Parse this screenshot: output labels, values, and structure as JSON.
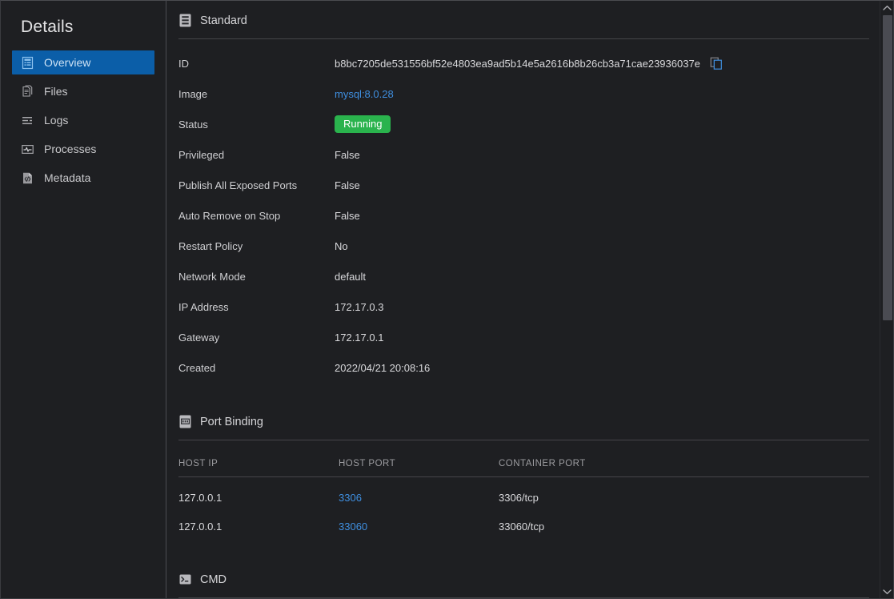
{
  "sidebar": {
    "title": "Details",
    "items": [
      {
        "label": "Overview",
        "icon": "overview-icon",
        "selected": true
      },
      {
        "label": "Files",
        "icon": "files-icon",
        "selected": false
      },
      {
        "label": "Logs",
        "icon": "logs-icon",
        "selected": false
      },
      {
        "label": "Processes",
        "icon": "processes-icon",
        "selected": false
      },
      {
        "label": "Metadata",
        "icon": "metadata-icon",
        "selected": false
      }
    ]
  },
  "standard": {
    "section_title": "Standard",
    "section_icon": "list-document-icon",
    "rows": [
      {
        "key": "ID",
        "value": "b8bc7205de531556bf52e4803ea9ad5b14e5a2616b8b26cb3a71cae23936037e",
        "kind": "text-copy"
      },
      {
        "key": "Image",
        "value": "mysql:8.0.28",
        "kind": "link"
      },
      {
        "key": "Status",
        "value": "Running",
        "kind": "badge"
      },
      {
        "key": "Privileged",
        "value": "False",
        "kind": "text"
      },
      {
        "key": "Publish All Exposed Ports",
        "value": "False",
        "kind": "text"
      },
      {
        "key": "Auto Remove on Stop",
        "value": "False",
        "kind": "text"
      },
      {
        "key": "Restart Policy",
        "value": "No",
        "kind": "text"
      },
      {
        "key": "Network Mode",
        "value": "default",
        "kind": "text"
      },
      {
        "key": "IP Address",
        "value": "172.17.0.3",
        "kind": "text"
      },
      {
        "key": "Gateway",
        "value": "172.17.0.1",
        "kind": "text"
      },
      {
        "key": "Created",
        "value": "2022/04/21 20:08:16",
        "kind": "text"
      }
    ],
    "copy_icon": "copy-icon",
    "status_badge_color": "#2ab34d",
    "link_color": "#3f8fe0"
  },
  "port_binding": {
    "section_title": "Port Binding",
    "section_icon": "network-port-icon",
    "columns": [
      "HOST IP",
      "HOST PORT",
      "CONTAINER PORT"
    ],
    "rows": [
      {
        "host_ip": "127.0.0.1",
        "host_port": "3306",
        "container_port": "3306/tcp"
      },
      {
        "host_ip": "127.0.0.1",
        "host_port": "33060",
        "container_port": "33060/tcp"
      }
    ]
  },
  "cmd": {
    "section_title": "CMD",
    "section_icon": "terminal-icon"
  },
  "scrollbar": {
    "up_icon": "chevron-up-icon",
    "down_icon": "chevron-down-icon"
  }
}
